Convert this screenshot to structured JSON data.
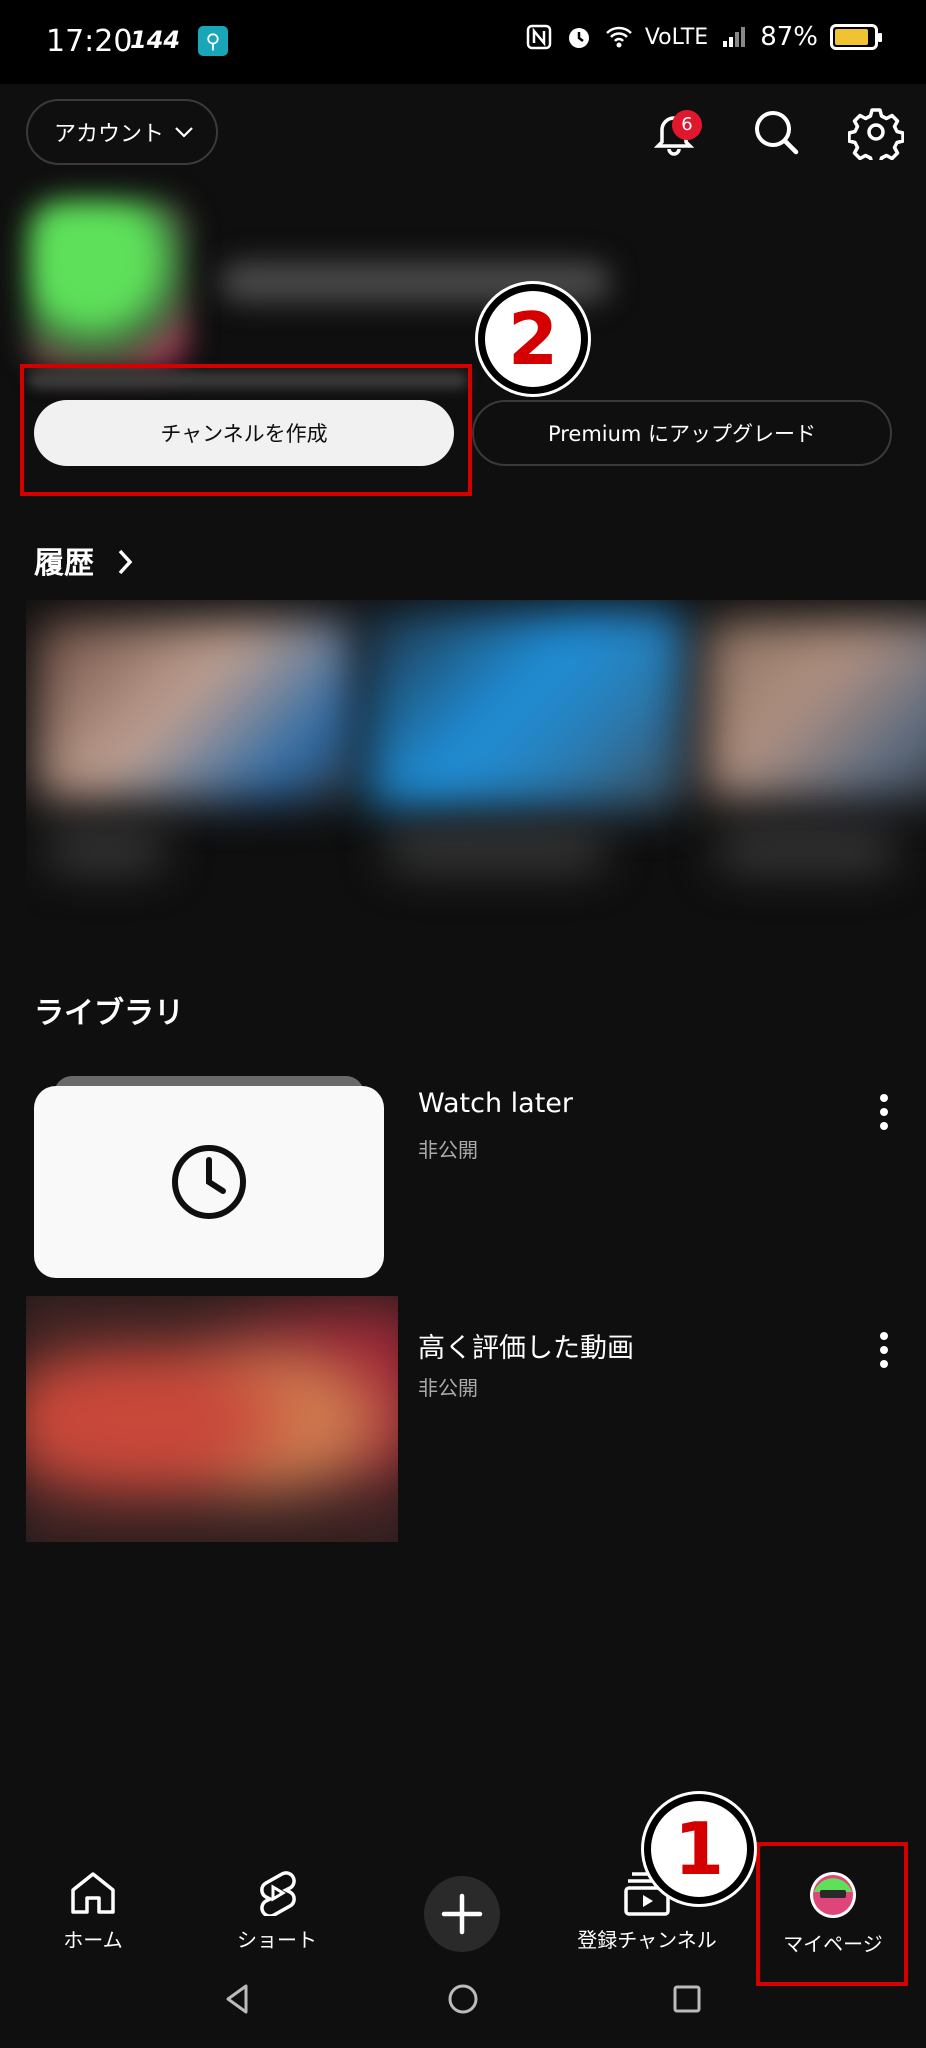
{
  "status_bar": {
    "time": "17:20",
    "refresh": "144",
    "network": "VoLTE",
    "battery": "87%",
    "battery_level": 0.87
  },
  "top_bar": {
    "account_label": "アカウント",
    "notification_count": "6"
  },
  "profile": {
    "create_channel_label": "チャンネルを作成",
    "premium_label": "Premium にアップグレード"
  },
  "annotations": {
    "step1": "1",
    "step2": "2",
    "color": "#d40000"
  },
  "history": {
    "title": "履歴"
  },
  "library": {
    "title": "ライブラリ",
    "items": [
      {
        "title": "Watch later",
        "subtitle": "非公開"
      },
      {
        "title": "高く評価した動画",
        "subtitle": "非公開"
      }
    ]
  },
  "bottom_nav": {
    "items": [
      {
        "label": "ホーム"
      },
      {
        "label": "ショート"
      },
      {
        "label": "登録チャンネル"
      },
      {
        "label": "マイページ"
      }
    ]
  }
}
